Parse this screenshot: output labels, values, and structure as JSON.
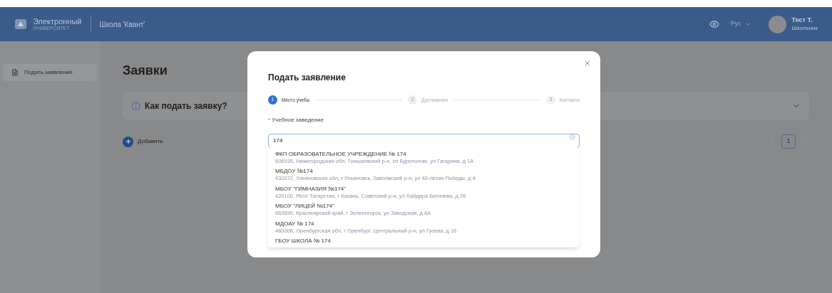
{
  "header": {
    "logo_title": "Электронный",
    "logo_subtitle": "УНИВЕРСИТЕТ",
    "school": "Школа 'Квант'",
    "language": "Рус",
    "user_name": "Тест Т.",
    "user_role": "Школьник"
  },
  "sidebar": {
    "items": [
      {
        "label": "Подать заявление",
        "selected": true
      }
    ]
  },
  "page": {
    "title": "Заявки",
    "info_panel": {
      "title": "Как подать заявку?",
      "expanded": false
    },
    "add_button": "Добавить",
    "pagination": {
      "pages": [
        {
          "label": "1",
          "selected": true
        }
      ]
    }
  },
  "modal": {
    "title": "Подать заявление",
    "steps": [
      {
        "number": "1",
        "label": "Место учебы",
        "active": true
      },
      {
        "number": "2",
        "label": "Достижения",
        "active": false
      },
      {
        "number": "3",
        "label": "Контакты",
        "active": false
      }
    ],
    "field": {
      "label": "Учебное заведение",
      "required_mark": "*",
      "value": "174"
    },
    "options": [
      {
        "name": "ФКП ОБРАЗОВАТЕЛЬНОЕ УЧРЕЖДЕНИЕ № 174",
        "address": "606935, Нижегородская обл, Тоншаевский р-н, сп Буреполом, ул Гагарина, д 1А"
      },
      {
        "name": "МБДОУ №174",
        "address": "432072, Ульяновская обл, г Ульяновск, Заволжский р-н, ул 40-летия Победы, д 4"
      },
      {
        "name": "МБОУ \"ГИМНАЗИЯ №174\"",
        "address": "420100, Респ Татарстан, г Казань, Советский р-н, ул Хайдара Бигичева, д 26"
      },
      {
        "name": "МБОУ \"ЛИЦЕЙ №174\"",
        "address": "663690, Красноярский край, г Зеленогорск, ул Заводская, д 8А"
      },
      {
        "name": "МДОАУ № 174",
        "address": "460006, Оренбургская обл, г Оренбург, Центральный р-н, ул Гусева, д 16"
      },
      {
        "name": "ГБОУ ШКОЛА № 174"
      }
    ]
  }
}
